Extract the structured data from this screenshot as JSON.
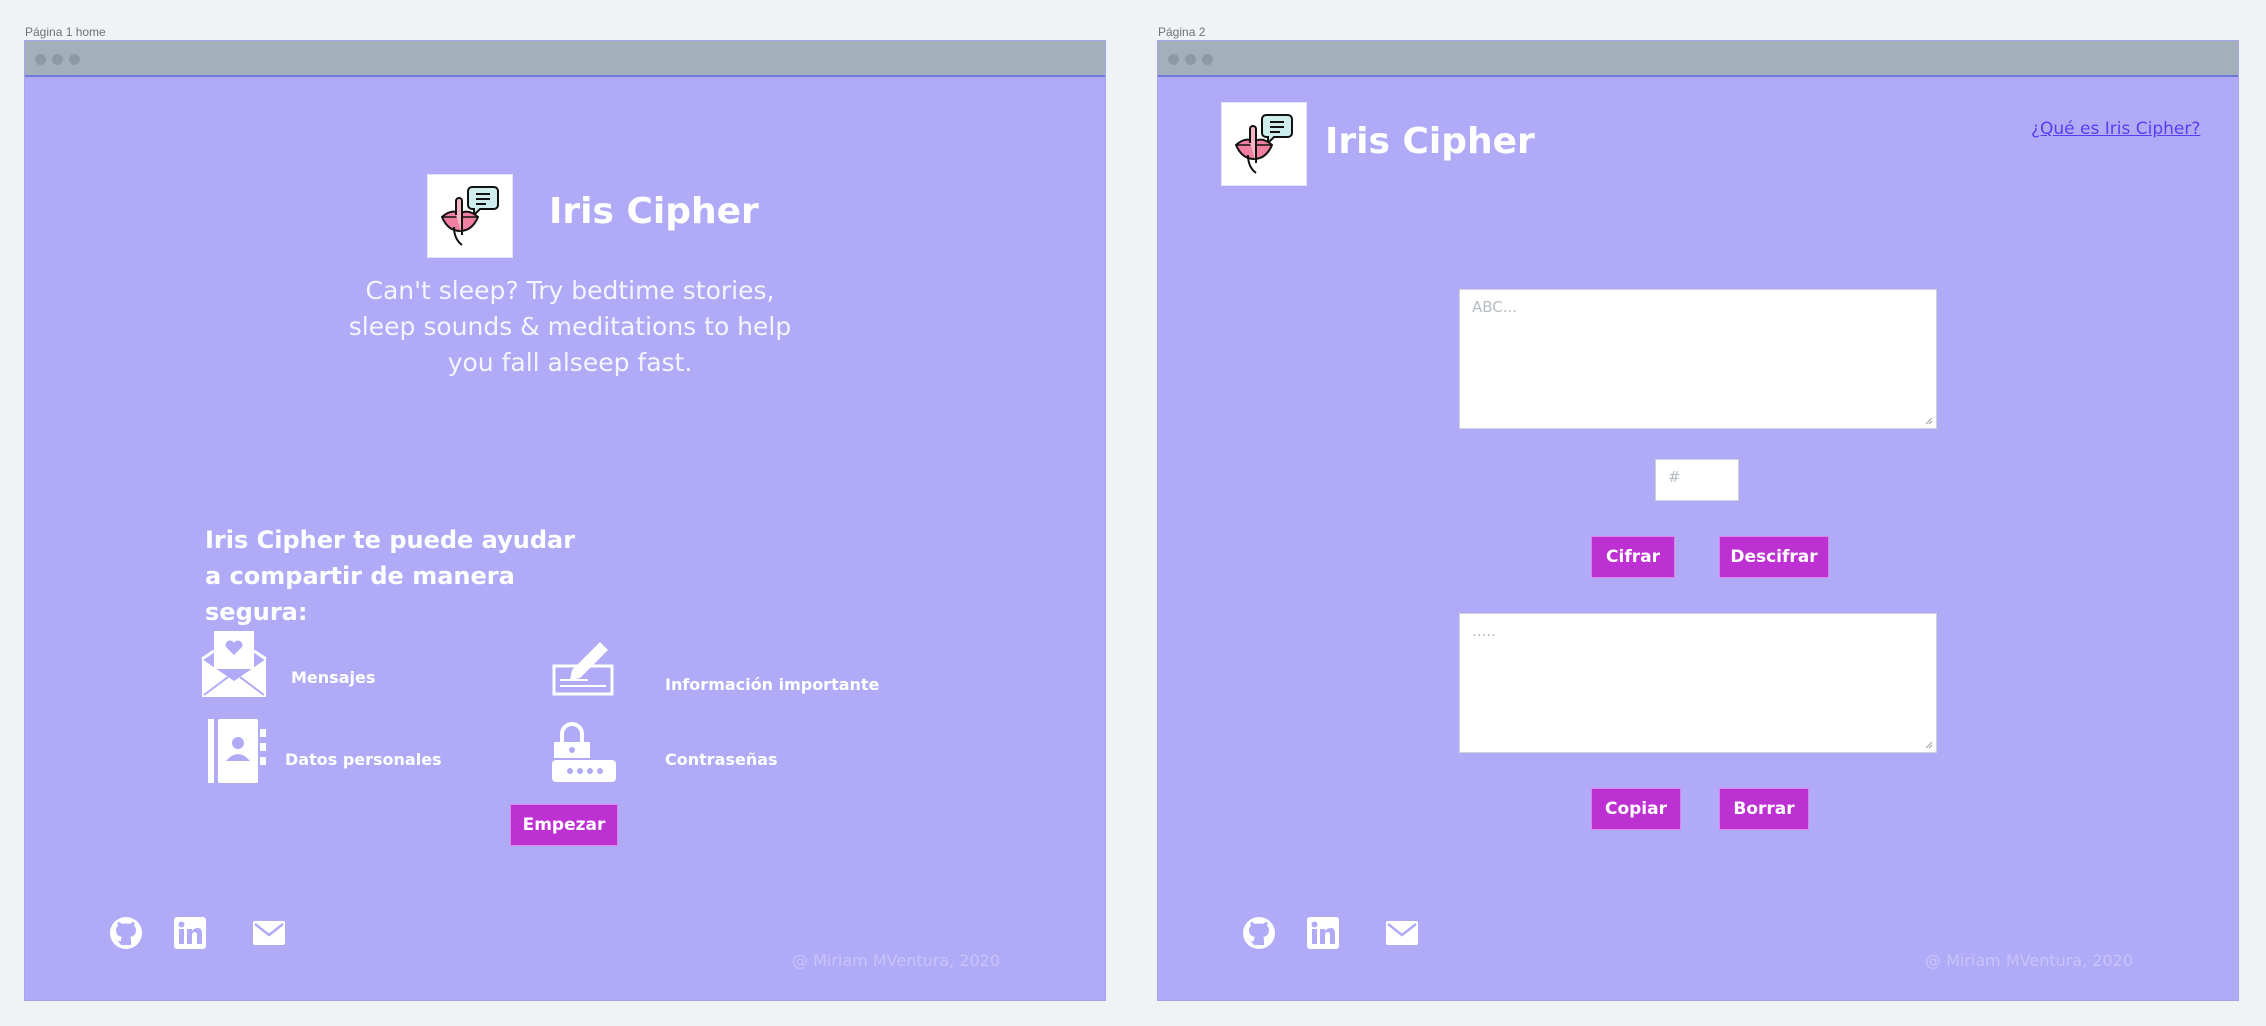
{
  "pages": [
    {
      "label": "Página 1 home",
      "brand": "Iris Cipher",
      "tagline": "Can't sleep? Try bedtime stories, sleep sounds & meditations to help you fall alseep fast.",
      "help_title": "Iris Cipher te puede ayudar a compartir de manera segura:",
      "features": [
        {
          "label": "Mensajes",
          "icon": "envelope-heart-icon"
        },
        {
          "label": "Información importante",
          "icon": "check-writing-icon"
        },
        {
          "label": "Datos personales",
          "icon": "contact-book-icon"
        },
        {
          "label": "Contraseñas",
          "icon": "padlock-password-icon"
        }
      ],
      "start_button": "Empezar",
      "footer": "@ Miriam MVentura, 2020",
      "socials": [
        "github-icon",
        "linkedin-icon",
        "mail-icon"
      ]
    },
    {
      "label": "Página 2",
      "brand": "Iris Cipher",
      "about_link": "¿Qué es Iris Cipher?",
      "input_placeholder": "ABC...",
      "offset_placeholder": "#",
      "cipher_button": "Cifrar",
      "decipher_button": "Descifrar",
      "output_placeholder": ".....",
      "copy_button": "Copiar",
      "clear_button": "Borrar",
      "footer": "@ Miriam MVentura, 2020",
      "socials": [
        "github-icon",
        "linkedin-icon",
        "mail-icon"
      ]
    }
  ],
  "colors": {
    "canvas": "#eff3f6",
    "frame": "#b1abf7",
    "titlebar": "#a2b0bb",
    "button": "#bd30d1",
    "link": "#5a3df0"
  }
}
